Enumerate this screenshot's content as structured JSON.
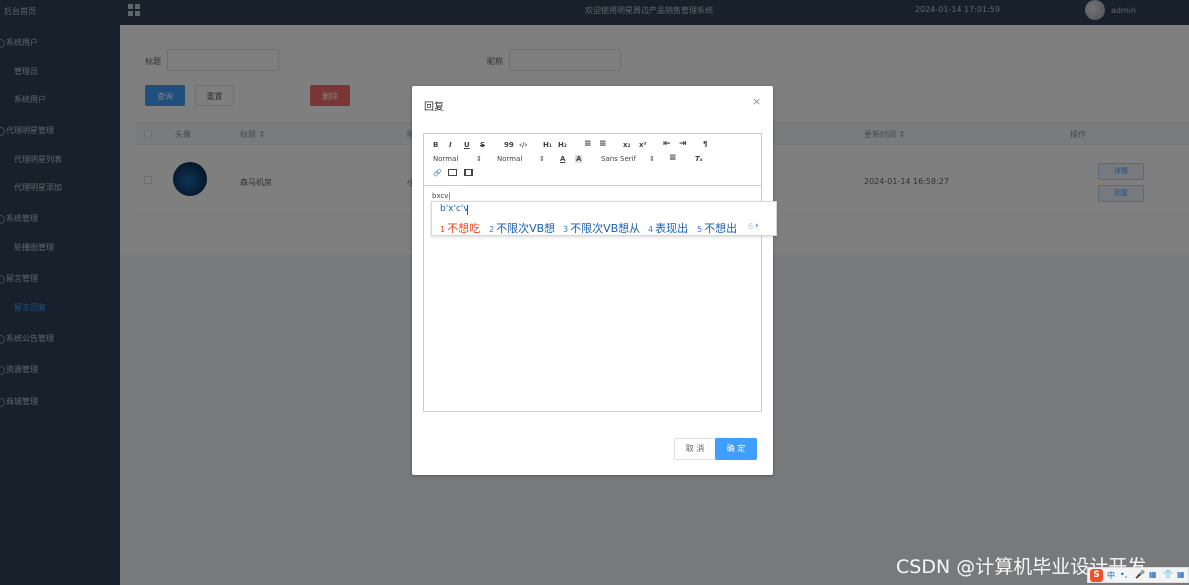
{
  "sidebar": {
    "brand": "后台首页",
    "items": [
      {
        "label": "系统用户",
        "level": "top"
      },
      {
        "label": "管理员",
        "level": "sub"
      },
      {
        "label": "系统用户",
        "level": "sub"
      },
      {
        "label": "代理明星管理",
        "level": "top"
      },
      {
        "label": "代理明星列表",
        "level": "sub"
      },
      {
        "label": "代理明星添加",
        "level": "sub"
      },
      {
        "label": "系统管理",
        "level": "top"
      },
      {
        "label": "轮播图管理",
        "level": "sub"
      },
      {
        "label": "留言管理",
        "level": "top"
      },
      {
        "label": "留言回复",
        "level": "sub",
        "active": true
      },
      {
        "label": "系统公告管理",
        "level": "top"
      },
      {
        "label": "资源管理",
        "level": "top"
      },
      {
        "label": "商城管理",
        "level": "top"
      }
    ]
  },
  "header": {
    "welcome": "欢迎使用明星周边产品销售管理系统",
    "datetime": "2024-01-14 17:01:59",
    "username": "admin"
  },
  "filters": {
    "title_label": "标题",
    "nickname_label": "昵称",
    "search_btn": "查询",
    "reset_btn": "重置",
    "delete_btn": "删除"
  },
  "table": {
    "headers": {
      "avatar": "头像",
      "title": "标题 ⇕",
      "col3": "昵",
      "updated": "更新时间 ⇕",
      "actions": "操作"
    },
    "row": {
      "title": "森马机房",
      "col3": "小",
      "updated": "2024-01-14 16:58:27",
      "detail_btn": "详情",
      "reply_btn": "回复"
    }
  },
  "dialog": {
    "title": "回复",
    "close_icon": "×",
    "toolbar": {
      "bold": "B",
      "italic": "I",
      "underline": "U",
      "strike": "S",
      "quote": "99",
      "code": "‹/›",
      "h1": "H₁",
      "h2": "H₂",
      "sub": "x₂",
      "sup": "x²",
      "size1": "Normal",
      "size2": "Normal",
      "font": "Sans Serif",
      "clean": "Tₓ"
    },
    "content": "bxcv|",
    "cancel_btn": "取 消",
    "ok_btn": "确 定"
  },
  "ime": {
    "composition": "b'x'c'v",
    "candidates": [
      {
        "num": "1",
        "text": "不想吃"
      },
      {
        "num": "2",
        "text": "不限次VB想"
      },
      {
        "num": "3",
        "text": "不限次VB想从"
      },
      {
        "num": "4",
        "text": "表现出"
      },
      {
        "num": "5",
        "text": "不想出"
      }
    ],
    "more_num": "6",
    "next_icon": "›"
  },
  "watermark": "CSDN @计算机毕业设计开发",
  "tray": {
    "logo": "S",
    "lang": "中"
  },
  "colors": {
    "sidebar_bg": "#304156",
    "primary": "#409eff",
    "danger": "#f56c6c"
  }
}
